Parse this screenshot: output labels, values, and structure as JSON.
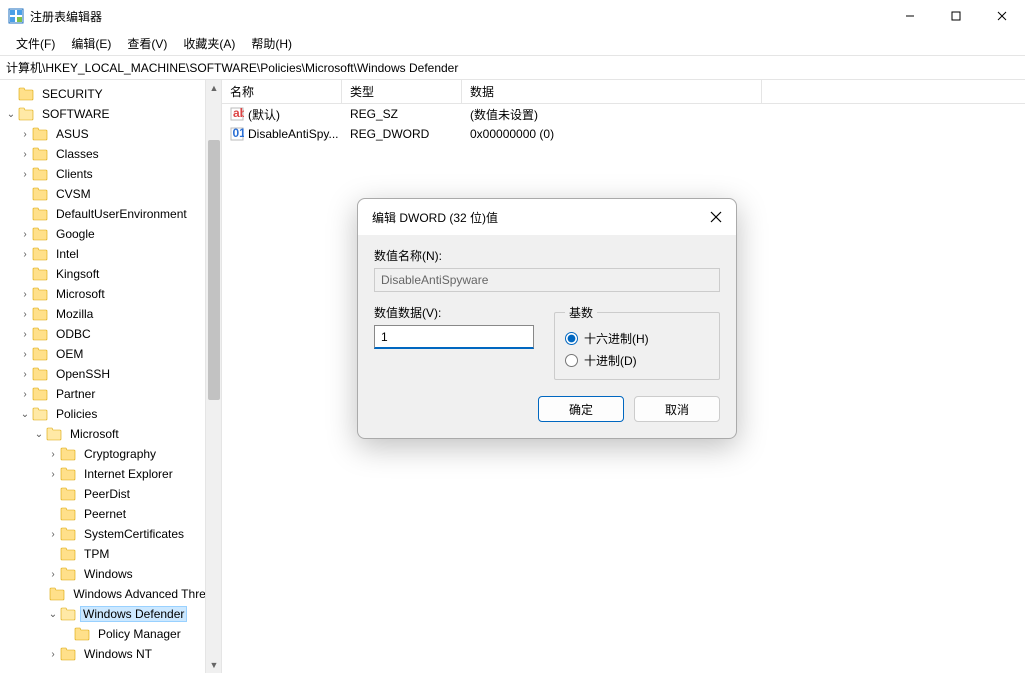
{
  "window": {
    "title": "注册表编辑器"
  },
  "menu": {
    "file": "文件(F)",
    "edit": "编辑(E)",
    "view": "查看(V)",
    "favorites": "收藏夹(A)",
    "help": "帮助(H)"
  },
  "addressbar": {
    "path": "计算机\\HKEY_LOCAL_MACHINE\\SOFTWARE\\Policies\\Microsoft\\Windows Defender"
  },
  "tree": [
    {
      "depth": 0,
      "twisty": "none",
      "label": "SECURITY",
      "open": false
    },
    {
      "depth": 0,
      "twisty": "open",
      "label": "SOFTWARE",
      "open": true
    },
    {
      "depth": 1,
      "twisty": "closed",
      "label": "ASUS"
    },
    {
      "depth": 1,
      "twisty": "closed",
      "label": "Classes"
    },
    {
      "depth": 1,
      "twisty": "closed",
      "label": "Clients"
    },
    {
      "depth": 1,
      "twisty": "none",
      "label": "CVSM"
    },
    {
      "depth": 1,
      "twisty": "none",
      "label": "DefaultUserEnvironment"
    },
    {
      "depth": 1,
      "twisty": "closed",
      "label": "Google"
    },
    {
      "depth": 1,
      "twisty": "closed",
      "label": "Intel"
    },
    {
      "depth": 1,
      "twisty": "none",
      "label": "Kingsoft"
    },
    {
      "depth": 1,
      "twisty": "closed",
      "label": "Microsoft"
    },
    {
      "depth": 1,
      "twisty": "closed",
      "label": "Mozilla"
    },
    {
      "depth": 1,
      "twisty": "closed",
      "label": "ODBC"
    },
    {
      "depth": 1,
      "twisty": "closed",
      "label": "OEM"
    },
    {
      "depth": 1,
      "twisty": "closed",
      "label": "OpenSSH"
    },
    {
      "depth": 1,
      "twisty": "closed",
      "label": "Partner"
    },
    {
      "depth": 1,
      "twisty": "open",
      "label": "Policies"
    },
    {
      "depth": 2,
      "twisty": "open",
      "label": "Microsoft"
    },
    {
      "depth": 3,
      "twisty": "closed",
      "label": "Cryptography"
    },
    {
      "depth": 3,
      "twisty": "closed",
      "label": "Internet Explorer"
    },
    {
      "depth": 3,
      "twisty": "none",
      "label": "PeerDist"
    },
    {
      "depth": 3,
      "twisty": "none",
      "label": "Peernet"
    },
    {
      "depth": 3,
      "twisty": "closed",
      "label": "SystemCertificates"
    },
    {
      "depth": 3,
      "twisty": "none",
      "label": "TPM"
    },
    {
      "depth": 3,
      "twisty": "closed",
      "label": "Windows"
    },
    {
      "depth": 3,
      "twisty": "none",
      "label": "Windows Advanced Threat Protection"
    },
    {
      "depth": 3,
      "twisty": "open",
      "label": "Windows Defender",
      "selected": true
    },
    {
      "depth": 4,
      "twisty": "none",
      "label": "Policy Manager"
    },
    {
      "depth": 3,
      "twisty": "closed",
      "label": "Windows NT"
    }
  ],
  "list": {
    "columns": {
      "name": "名称",
      "type": "类型",
      "data": "数据"
    },
    "rows": [
      {
        "icon": "sz",
        "name": "(默认)",
        "type": "REG_SZ",
        "data": "(数值未设置)"
      },
      {
        "icon": "dw",
        "name": "DisableAntiSpy...",
        "type": "REG_DWORD",
        "data": "0x00000000 (0)"
      }
    ]
  },
  "dialog": {
    "title": "编辑 DWORD (32 位)值",
    "name_label": "数值名称(N):",
    "name_value": "DisableAntiSpyware",
    "data_label": "数值数据(V):",
    "data_value": "1",
    "base_legend": "基数",
    "radio_hex": "十六进制(H)",
    "radio_dec": "十进制(D)",
    "ok": "确定",
    "cancel": "取消"
  }
}
